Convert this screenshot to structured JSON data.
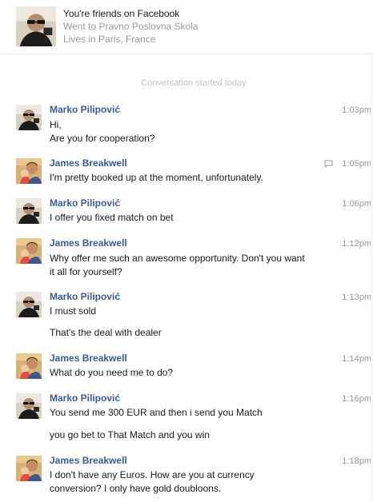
{
  "header": {
    "title": "You're friends on Facebook",
    "education": "Went to Pravno Poslovna Skola",
    "location": "Lives in Paris, France"
  },
  "conversation_start": "Conversation started today",
  "messages": [
    {
      "sender": "Marko Pilipović",
      "time": "1:03pm",
      "lines": [
        "Hi,",
        "Are you for cooperation?"
      ]
    },
    {
      "sender": "James Breakwell",
      "time": "1:05pm",
      "lines": [
        "I'm pretty booked up at the moment, unfortunately."
      ]
    },
    {
      "sender": "Marko Pilipović",
      "time": "1:06pm",
      "lines": [
        "I offer you fixed match on bet"
      ]
    },
    {
      "sender": "James Breakwell",
      "time": "1:12pm",
      "lines": [
        "Why offer me such an awesome opportunity. Don't you want",
        "it all for yourself?"
      ]
    },
    {
      "sender": "Marko Pilipović",
      "time": "1:13pm",
      "lines": [
        "I must sold",
        "That's the deal with dealer"
      ]
    },
    {
      "sender": "James Breakwell",
      "time": "1:14pm",
      "lines": [
        "What do you need me to do?"
      ]
    },
    {
      "sender": "Marko Pilipović",
      "time": "1:16pm",
      "lines": [
        "You send me 300 EUR and then i send you Match",
        "you go bet to That Match and you win"
      ]
    },
    {
      "sender": "James Breakwell",
      "time": "1:18pm",
      "lines": [
        "I don't have any Euros. How are you at currency",
        "conversion? I only have gold doubloons."
      ]
    }
  ],
  "icons": {
    "marko_avatar": "avatar-man-sunglasses",
    "james_avatar": "avatar-man-with-baby",
    "seen": "speech-bubble-icon"
  },
  "colors": {
    "sender_name": "#3b5998",
    "muted": "#9197a3",
    "text": "#141823"
  }
}
